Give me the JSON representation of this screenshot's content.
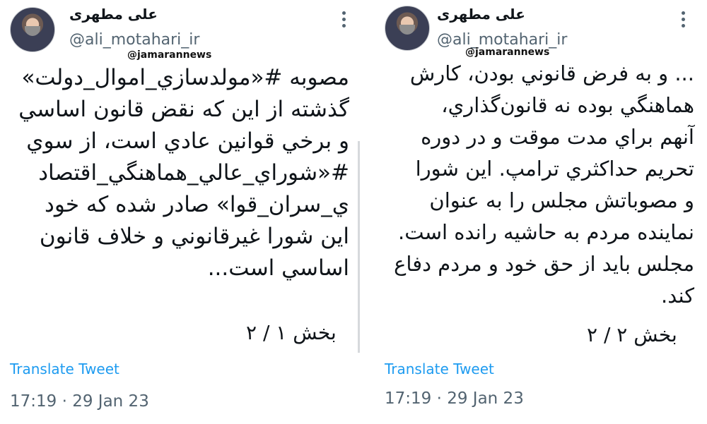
{
  "tweets": [
    {
      "display_name": "علی مطهری",
      "handle": "@ali_motahari_ir",
      "watermark": "@jamarannews",
      "text": "مصوبه #«مولدسازي_اموال_دولت»\nگذشته از اين كه نقض قانون اساسي\nو برخي قوانين عادي است، از سوي\n#«شوراي_عالي_هماهنگي_اقتصاد\nي_سران_قوا» صادر شده كه خود\nاين شورا غيرقانوني و خلاف قانون\nاساسي است...",
      "part": "بخش ۱ / ۲",
      "translate": "Translate Tweet",
      "timestamp": "17:19 · 29 Jan 23"
    },
    {
      "display_name": "علی مطهری",
      "handle": "@ali_motahari_ir",
      "watermark": "@jamarannews",
      "text": "... و به فرض قانوني بودن، كارش\nهماهنگي بوده نه قانون‌گذاري،\nآنهم براي مدت موقت و در دوره\nتحريم حداكثري ترامپ. اين شورا\nو مصوباتش مجلس را به عنوان\nنماينده مردم به حاشيه رانده است.\nمجلس بايد از حق خود و مردم دفاع\nكند.",
      "part": "بخش ۲ / ۲",
      "translate": "Translate Tweet",
      "timestamp": "17:19 · 29 Jan 23"
    }
  ]
}
